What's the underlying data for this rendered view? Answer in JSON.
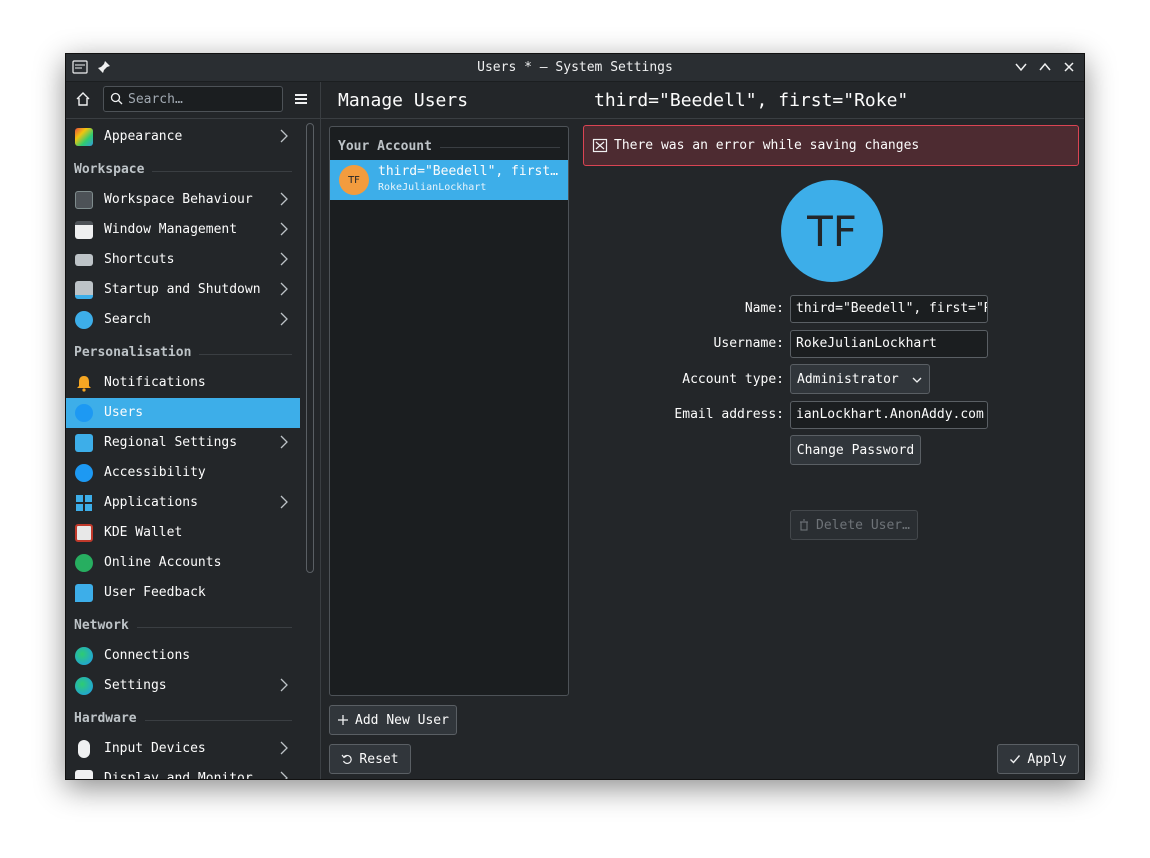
{
  "window": {
    "title": "Users * — System Settings"
  },
  "sidebar": {
    "search_placeholder": "Search…",
    "items": [
      {
        "label": "Appearance",
        "icon": "appearance-icon",
        "chevron": true
      },
      {
        "section": "Workspace"
      },
      {
        "label": "Workspace Behaviour",
        "icon": "workspace-behaviour-icon",
        "chevron": true
      },
      {
        "label": "Window Management",
        "icon": "window-management-icon",
        "chevron": true
      },
      {
        "label": "Shortcuts",
        "icon": "keyboard-icon",
        "chevron": true
      },
      {
        "label": "Startup and Shutdown",
        "icon": "startup-icon",
        "chevron": true
      },
      {
        "label": "Search",
        "icon": "search-icon",
        "chevron": true
      },
      {
        "section": "Personalisation"
      },
      {
        "label": "Notifications",
        "icon": "bell-icon",
        "chevron": false
      },
      {
        "label": "Users",
        "icon": "users-icon",
        "chevron": false,
        "selected": true
      },
      {
        "label": "Regional Settings",
        "icon": "regional-settings-icon",
        "chevron": true
      },
      {
        "label": "Accessibility",
        "icon": "accessibility-icon",
        "chevron": false
      },
      {
        "label": "Applications",
        "icon": "applications-icon",
        "chevron": true
      },
      {
        "label": "KDE Wallet",
        "icon": "wallet-icon",
        "chevron": false
      },
      {
        "label": "Online Accounts",
        "icon": "online-accounts-icon",
        "chevron": false
      },
      {
        "label": "User Feedback",
        "icon": "feedback-icon",
        "chevron": false
      },
      {
        "section": "Network"
      },
      {
        "label": "Connections",
        "icon": "globe-icon",
        "chevron": false
      },
      {
        "label": "Settings",
        "icon": "globe-icon",
        "chevron": true
      },
      {
        "section": "Hardware"
      },
      {
        "label": "Input Devices",
        "icon": "mouse-icon",
        "chevron": true
      },
      {
        "label": "Display and Monitor",
        "icon": "display-icon",
        "chevron": true
      }
    ]
  },
  "header": {
    "page_title": "Manage Users",
    "user_title": "third=\"Beedell\", first=\"Roke\""
  },
  "user_list": {
    "section": "Your Account",
    "users": [
      {
        "initials": "TF",
        "name": "third=\"Beedell\", first=\"Roke\"",
        "login": "RokeJulianLockhart"
      }
    ]
  },
  "error": {
    "message": "There was an error while saving changes"
  },
  "details": {
    "avatar_initials": "TF",
    "name_label": "Name:",
    "name_value": "third=\"Beedell\", first=\"Roke\"",
    "username_label": "Username:",
    "username_value": "RokeJulianLockhart",
    "account_type_label": "Account type:",
    "account_type_value": "Administrator",
    "email_label": "Email address:",
    "email_value": "ianLockhart.AnonAddy.com",
    "change_password": "Change Password",
    "delete_user": "Delete User…"
  },
  "buttons": {
    "add_user": "Add New User",
    "reset": "Reset",
    "apply": "Apply"
  },
  "colors": {
    "accent": "#3daee9",
    "background": "#232629",
    "error_border": "#da4453"
  }
}
